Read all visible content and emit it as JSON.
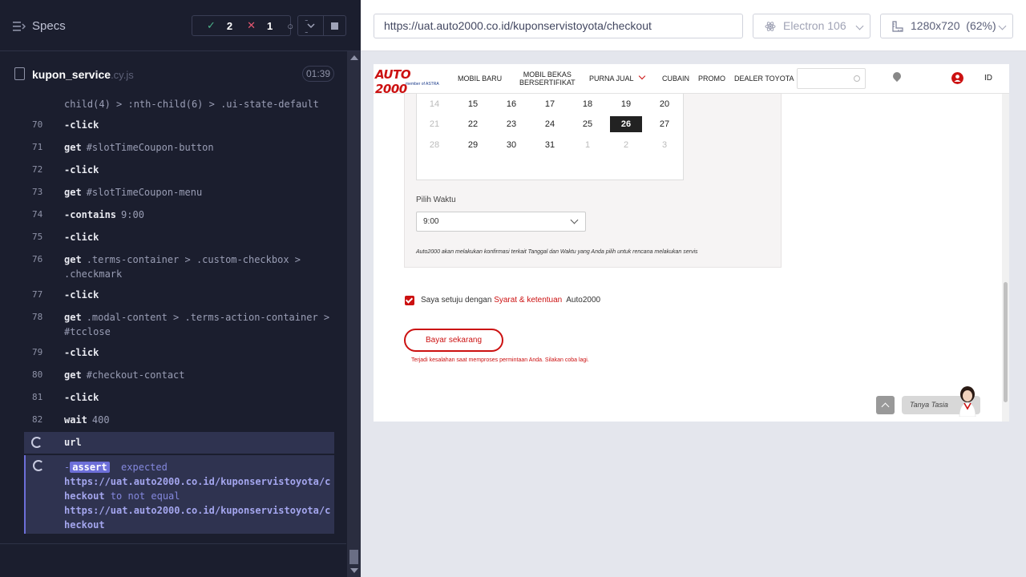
{
  "runner": {
    "specs_label": "Specs",
    "passed": "2",
    "failed": "1",
    "pending": "--",
    "spec_file": "kupon_service",
    "spec_ext": ".cy.js",
    "duration": "01:39"
  },
  "commands": {
    "overflow_arg": "child(4) > :nth-child(6) > .ui-state-default",
    "rows": [
      {
        "num": "70",
        "name": "-click",
        "arg": ""
      },
      {
        "num": "71",
        "name": "get",
        "arg": "#slotTimeCoupon-button"
      },
      {
        "num": "72",
        "name": "-click",
        "arg": ""
      },
      {
        "num": "73",
        "name": "get",
        "arg": "#slotTimeCoupon-menu"
      },
      {
        "num": "74",
        "name": "-contains",
        "arg": "9:00"
      },
      {
        "num": "75",
        "name": "-click",
        "arg": ""
      },
      {
        "num": "76",
        "name": "get",
        "arg": ".terms-container > .custom-checkbox >"
      },
      {
        "num": "77",
        "name": "-click",
        "arg": ""
      },
      {
        "num": "78",
        "name": "get",
        "arg": ".modal-content > .terms-action-container >"
      },
      {
        "num": "79",
        "name": "-click",
        "arg": ""
      },
      {
        "num": "80",
        "name": "get",
        "arg": "#checkout-contact"
      },
      {
        "num": "81",
        "name": "-click",
        "arg": ""
      },
      {
        "num": "82",
        "name": "wait",
        "arg": "400"
      }
    ],
    "row76_cont": ".checkmark",
    "row78_cont": "#tcclose",
    "url_cmd": "url",
    "assert": {
      "dash": "-",
      "tag": "assert",
      "expected_word": "expected",
      "line1": "https://uat.auto2000.co.id/kuponservistoyota/c",
      "line2a": "heckout",
      "to_not_equal": "to not equal",
      "line3": "https://uat.auto2000.co.id/kuponservistoyota/c",
      "line4": "heckout"
    }
  },
  "browser": {
    "url": "https://uat.auto2000.co.id/kuponservistoyota/checkout",
    "browser_name": "Electron 106",
    "viewport": "1280x720",
    "zoom": "(62%)"
  },
  "site": {
    "logo_text": "AUTO 2000",
    "logo_sub": "member of ASTRA",
    "nav": {
      "mobil_baru": "MOBIL BARU",
      "mobil_bekas_1": "MOBIL BEKAS",
      "mobil_bekas_2": "BERSERTIFIKAT",
      "purna_jual": "PURNA JUAL",
      "cubain": "CUBAIN",
      "promo": "PROMO",
      "dealer": "DEALER TOYOTA",
      "lang": "ID"
    },
    "calendar_rows": [
      [
        {
          "d": "14",
          "s": "dim"
        },
        {
          "d": "15",
          "s": ""
        },
        {
          "d": "16",
          "s": ""
        },
        {
          "d": "17",
          "s": ""
        },
        {
          "d": "18",
          "s": ""
        },
        {
          "d": "19",
          "s": ""
        },
        {
          "d": "20",
          "s": ""
        }
      ],
      [
        {
          "d": "21",
          "s": "dim"
        },
        {
          "d": "22",
          "s": ""
        },
        {
          "d": "23",
          "s": ""
        },
        {
          "d": "24",
          "s": ""
        },
        {
          "d": "25",
          "s": ""
        },
        {
          "d": "26",
          "s": "sel"
        },
        {
          "d": "27",
          "s": ""
        }
      ],
      [
        {
          "d": "28",
          "s": "dim"
        },
        {
          "d": "29",
          "s": ""
        },
        {
          "d": "30",
          "s": ""
        },
        {
          "d": "31",
          "s": ""
        },
        {
          "d": "1",
          "s": "dim"
        },
        {
          "d": "2",
          "s": "dim"
        },
        {
          "d": "3",
          "s": "dim"
        }
      ]
    ],
    "time_label": "Pilih Waktu",
    "time_value": "9:00",
    "confirm_note": "Auto2000 akan melakukan konfirmasi terkait Tanggal dan Waktu yang Anda pilih untuk rencana melakukan servis",
    "agree_prefix": "Saya setuju dengan",
    "agree_link": "Syarat & ketentuan",
    "agree_suffix": "Auto2000",
    "pay_button": "Bayar sekarang",
    "error": "Terjadi kesalahan saat memproses permintaan Anda. Silakan coba lagi.",
    "chat_label": "Tanya Tasia"
  }
}
